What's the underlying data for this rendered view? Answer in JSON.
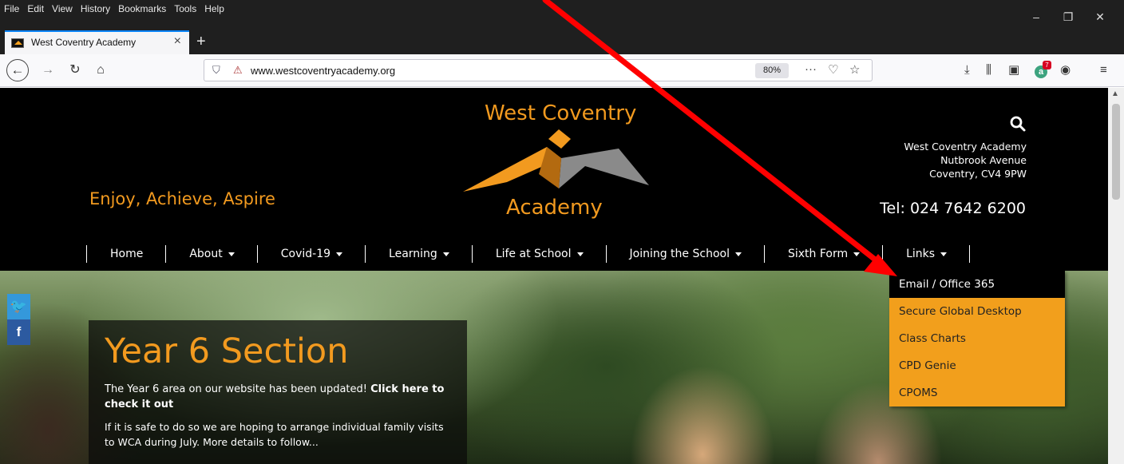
{
  "browser": {
    "menu": [
      "File",
      "Edit",
      "View",
      "History",
      "Bookmarks",
      "Tools",
      "Help"
    ],
    "tab_title": "West Coventry Academy",
    "tab_close": "×",
    "new_tab": "+",
    "url": "www.westcoventryacademy.org",
    "zoom": "80%",
    "page_actions": "···",
    "addon_badge": "7",
    "addon_letter": "a",
    "window_controls": [
      "–",
      "❐",
      "✕"
    ],
    "icons": [
      "back-arrow-icon",
      "forward-arrow-icon",
      "reload-icon",
      "home-icon",
      "shield-icon",
      "lock-icon",
      "pocket-icon",
      "star-icon",
      "download-icon",
      "library-icon",
      "sidebar-icon",
      "account-icon",
      "hamburger-menu-icon"
    ]
  },
  "site": {
    "tagline": "Enjoy, Achieve, Aspire",
    "logo_top": "West Coventry",
    "logo_bottom": "Academy",
    "address": [
      "West Coventry Academy",
      "Nutbrook Avenue",
      "Coventry, CV4 9PW"
    ],
    "tel": "Tel: 024 7642 6200",
    "nav": [
      {
        "label": "Home",
        "caret": false
      },
      {
        "label": "About",
        "caret": true
      },
      {
        "label": "Covid-19",
        "caret": true
      },
      {
        "label": "Learning",
        "caret": true
      },
      {
        "label": "Life at School",
        "caret": true
      },
      {
        "label": "Joining the School",
        "caret": true
      },
      {
        "label": "Sixth Form",
        "caret": true
      },
      {
        "label": "Links",
        "caret": true
      }
    ],
    "links_dropdown": [
      "Email / Office 365",
      "Secure Global Desktop",
      "Class Charts",
      "CPD Genie",
      "CPOMS"
    ],
    "social": {
      "twitter": "🐦",
      "facebook": "f"
    },
    "promo": {
      "title": "Year 6 Section",
      "text1_a": "The Year 6 area on our website has been updated!",
      "text1_link": "Click here to check it out",
      "text2": "If it is safe to do so we are hoping to arrange individual family visits to WCA during July. More details to follow..."
    },
    "colors": {
      "accent": "#f29a1f",
      "header_bg": "#000000",
      "dropdown_bg": "#f29f1c",
      "annotation_arrow": "#ff0000"
    }
  }
}
